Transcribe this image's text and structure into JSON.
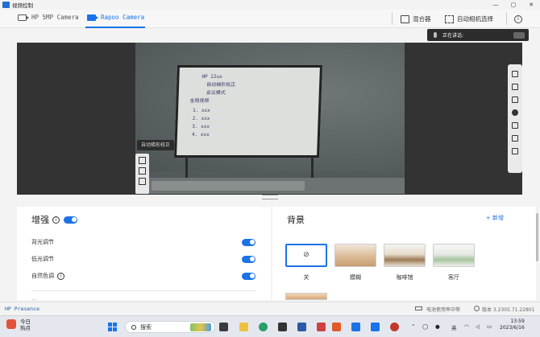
{
  "window": {
    "title": "视频控制",
    "controls": [
      "—",
      "▢",
      "✕"
    ]
  },
  "cameras": [
    {
      "label": "HP 5MP Camera",
      "active": false
    },
    {
      "label": "Rapoo Camera",
      "active": true
    }
  ],
  "toolbar": {
    "mixer_label": "混合器",
    "auto_select_label": "自动相机选择",
    "info_label": "i"
  },
  "speech": {
    "text": "正在讲话:"
  },
  "video": {
    "tooltip": "自动梯形校正",
    "board_lines": [
      "HP 22ux",
      "自动梯形校正",
      "会议模式",
      "全局视频",
      "1. xxx",
      "2. xxx",
      "3. xxx",
      "4. xxx"
    ]
  },
  "enhance": {
    "title": "增强",
    "enabled": true,
    "rows": [
      {
        "label": "背光调节",
        "info": false,
        "on": true
      },
      {
        "label": "低光调节",
        "info": false,
        "on": true
      },
      {
        "label": "自然色调",
        "info": true,
        "on": true
      }
    ],
    "cut_text": "..."
  },
  "background": {
    "title": "背景",
    "add_label": "+ 新增",
    "items": [
      {
        "label": "关",
        "icon": "⊘",
        "selected": true
      },
      {
        "label": "模糊",
        "selected": false
      },
      {
        "label": "咖啡馆",
        "selected": false
      },
      {
        "label": "客厅",
        "selected": false
      }
    ]
  },
  "status": {
    "app_name": "HP Presence",
    "battery": "电池使用率中等",
    "version": "版本 3.2305.71.22801"
  },
  "taskbar": {
    "weather_line1": "今日",
    "weather_line2": "热点",
    "search_label": "搜索",
    "lang": "英",
    "time": "13:59",
    "date": "2023/6/16"
  },
  "colors": {
    "accent": "#1a73e8"
  }
}
